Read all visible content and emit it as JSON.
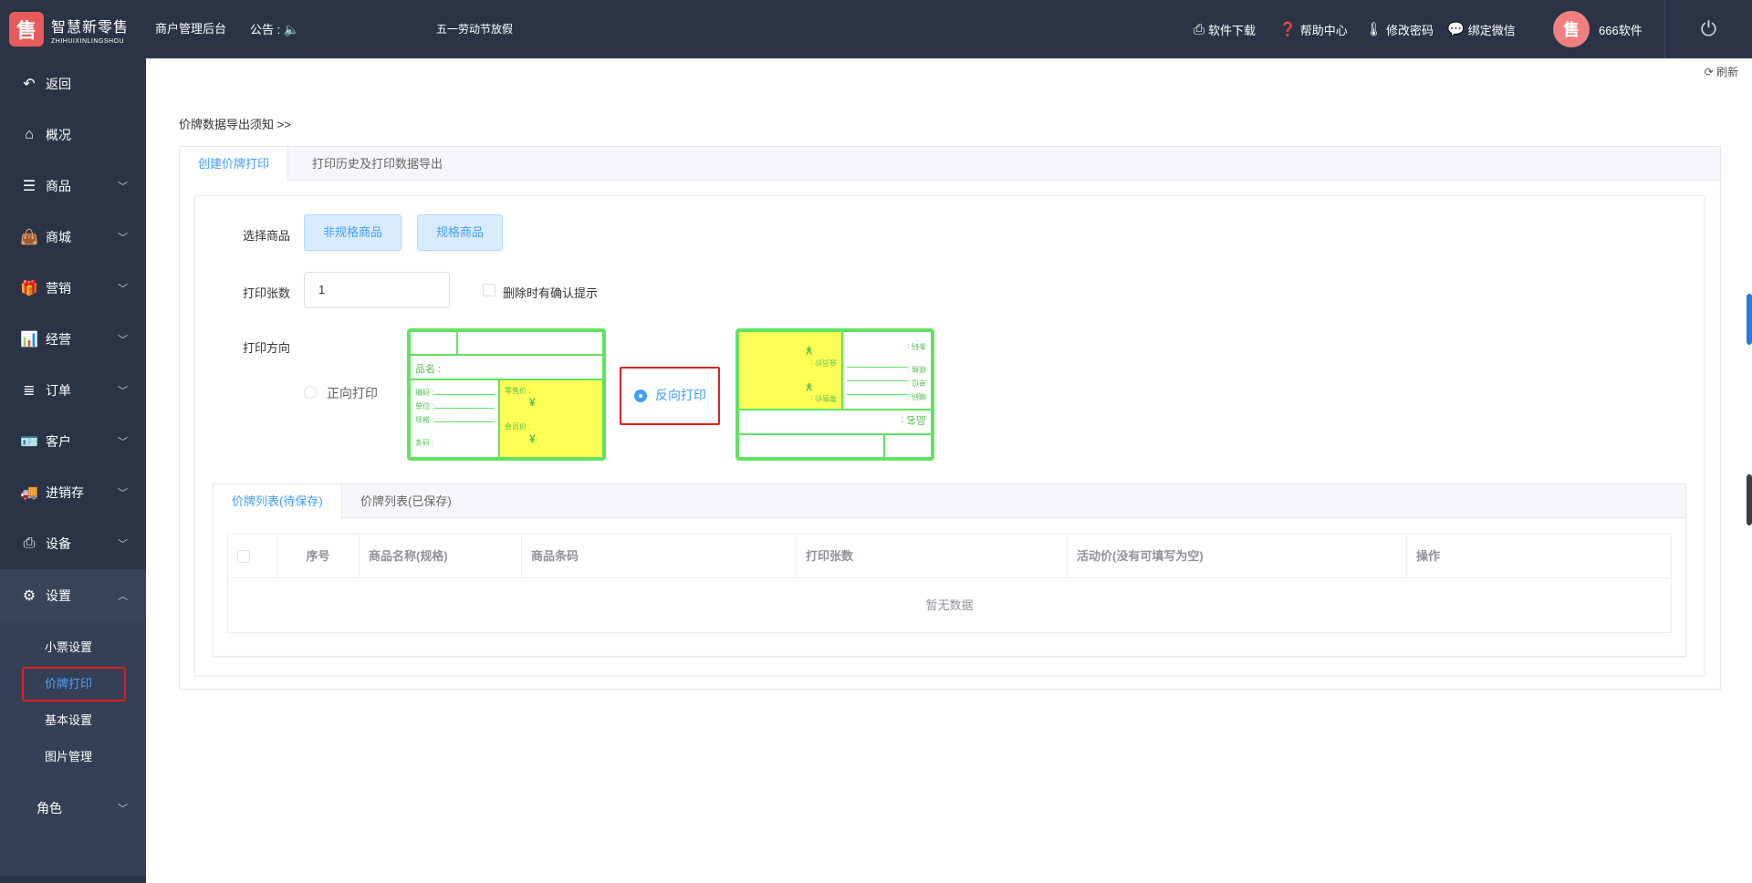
{
  "header": {
    "brand_cn": "智慧新零售",
    "brand_en": "ZHIHUIXINLINGSHOU",
    "system_title": "商户管理后台",
    "notice_label": "公告 :",
    "announcement": "五一劳动节放假",
    "links": [
      "软件下载",
      "帮助中心",
      "修改密码",
      "绑定微信"
    ],
    "user_name": "666软件"
  },
  "sidebar": {
    "items": [
      {
        "label": "返回",
        "icon": "back-icon"
      },
      {
        "label": "概况",
        "icon": "home-icon"
      },
      {
        "label": "商品",
        "icon": "list-icon"
      },
      {
        "label": "商城",
        "icon": "shopping-bag-icon"
      },
      {
        "label": "营销",
        "icon": "gift-icon"
      },
      {
        "label": "经营",
        "icon": "bar-chart-icon"
      },
      {
        "label": "订单",
        "icon": "order-list-icon"
      },
      {
        "label": "客户",
        "icon": "id-card-icon"
      },
      {
        "label": "进销存",
        "icon": "truck-icon"
      },
      {
        "label": "设备",
        "icon": "printer-icon"
      },
      {
        "label": "设置",
        "icon": "gear-icon"
      }
    ],
    "sub_items": [
      "小票设置",
      "价牌打印",
      "基本设置",
      "图片管理"
    ],
    "role_label": "角色"
  },
  "main": {
    "refresh_label": "刷新",
    "notice_link": "价牌数据导出须知 >>",
    "tabs": [
      "创建价牌打印",
      "打印历史及打印数据导出"
    ],
    "form": {
      "select_goods_label": "选择商品",
      "btn_non_spec": "非规格商品",
      "btn_spec": "规格商品",
      "print_count_label": "打印张数",
      "print_count_value": "1",
      "delete_confirm_label": "删除时有确认提示",
      "direction_label": "打印方向",
      "forward_label": "正向打印",
      "reverse_label": "反向打印"
    },
    "tag_preview": {
      "name": "品名 :",
      "code": "编码 :",
      "unit": "单位 :",
      "spec": "规格 :",
      "barcode": "条码 :",
      "retail_price": "零售价 :",
      "member_price": "会员价 :",
      "currency": "¥"
    },
    "list_tabs": [
      "价牌列表(待保存)",
      "价牌列表(已保存)"
    ],
    "table_headers": [
      "序号",
      "商品名称(规格)",
      "商品条码",
      "打印张数",
      "活动价(没有可填写为空)",
      "操作"
    ],
    "empty_text": "暂无数据"
  }
}
